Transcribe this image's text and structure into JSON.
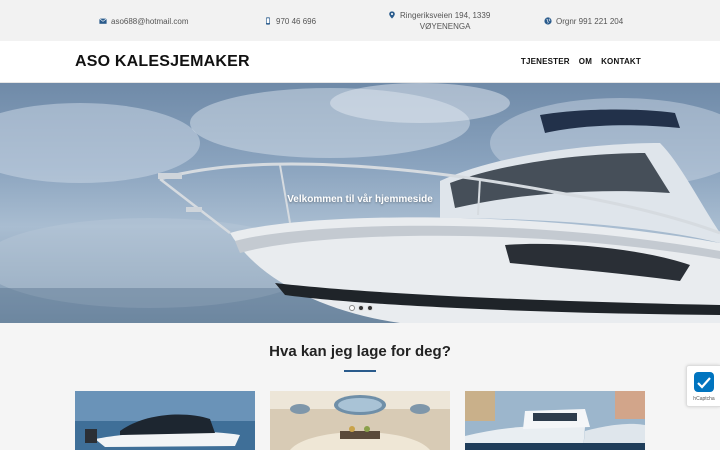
{
  "topbar": {
    "email": "aso688@hotmail.com",
    "phone": "970 46 696",
    "address_line1": "Ringeriksveien 194, 1339",
    "address_line2": "VØYENENGA",
    "orgnr": "Orgnr 991 221 204"
  },
  "header": {
    "logo": "ASO KALESJEMAKER",
    "nav": [
      "TJENESTER",
      "OM",
      "KONTAKT"
    ]
  },
  "hero": {
    "title": "Velkommen til vår hjemmeside",
    "slide_count": 3,
    "active_slide": 1
  },
  "services": {
    "title": "Hva kan jeg lage for deg?"
  },
  "captcha": {
    "label": "hCaptcha"
  },
  "colors": {
    "accent": "#2a5b8c",
    "icon": "#2a5b8c"
  }
}
